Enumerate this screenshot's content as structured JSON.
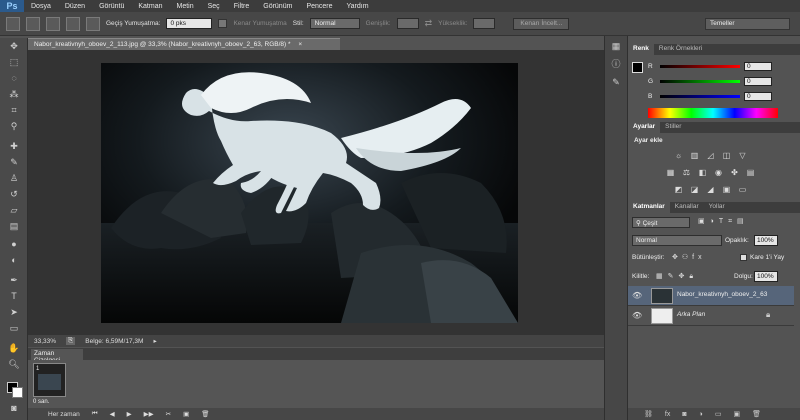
{
  "menubar": {
    "logo": "Ps",
    "items": [
      "Dosya",
      "Düzen",
      "Görüntü",
      "Katman",
      "Metin",
      "Seç",
      "Filtre",
      "Görünüm",
      "Pencere",
      "Yardım"
    ]
  },
  "options": {
    "feather_label": "Geçiş Yumuşatma:",
    "feather_value": "0 pks",
    "antialias_label": "Kenar Yumuşatma",
    "style_label": "Stil:",
    "style_value": "Normal",
    "width_label": "Genişlik:",
    "height_label": "Yükseklik:",
    "refine_label": "Kenarı İncelt...",
    "workspace": "Temeller"
  },
  "document": {
    "tab_title": "Nabor_kreativnyh_oboev_2_113.jpg @ 33,3% (Nabor_kreativnyh_oboev_2_63, RGB/8) *",
    "zoom": "33,33%",
    "doc_info": "Belge: 6,59M/17,3M"
  },
  "timeline": {
    "tab": "Zaman Çizelgesi",
    "frame_time": "0 san.",
    "loop": "Her zaman"
  },
  "color_panel": {
    "tabs": [
      "Renk",
      "Renk Örnekleri"
    ],
    "channels": [
      {
        "letter": "R",
        "value": "0"
      },
      {
        "letter": "G",
        "value": "0"
      },
      {
        "letter": "B",
        "value": "0"
      }
    ]
  },
  "adjust_panel": {
    "tabs": [
      "Ayarlar",
      "Stiller"
    ],
    "title": "Ayar ekle"
  },
  "layers_panel": {
    "tabs": [
      "Katmanlar",
      "Kanallar",
      "Yollar"
    ],
    "filter": "Çeşit",
    "blend": "Normal",
    "opacity_label": "Opaklık:",
    "opacity_value": "100%",
    "unify_label": "Bütünleştir:",
    "propagate_label": "Kare 1'i Yay",
    "lock_label": "Kilitle:",
    "fill_label": "Dolgu:",
    "fill_value": "100%",
    "layers": [
      {
        "name": "Nabor_kreativnyh_oboev_2_63",
        "selected": true
      },
      {
        "name": "Arka Plan",
        "selected": false
      }
    ]
  },
  "colors": {
    "accent": "#3e80c4",
    "panel_bg": "#535353",
    "canvas_bg": "#0c0c0c"
  }
}
